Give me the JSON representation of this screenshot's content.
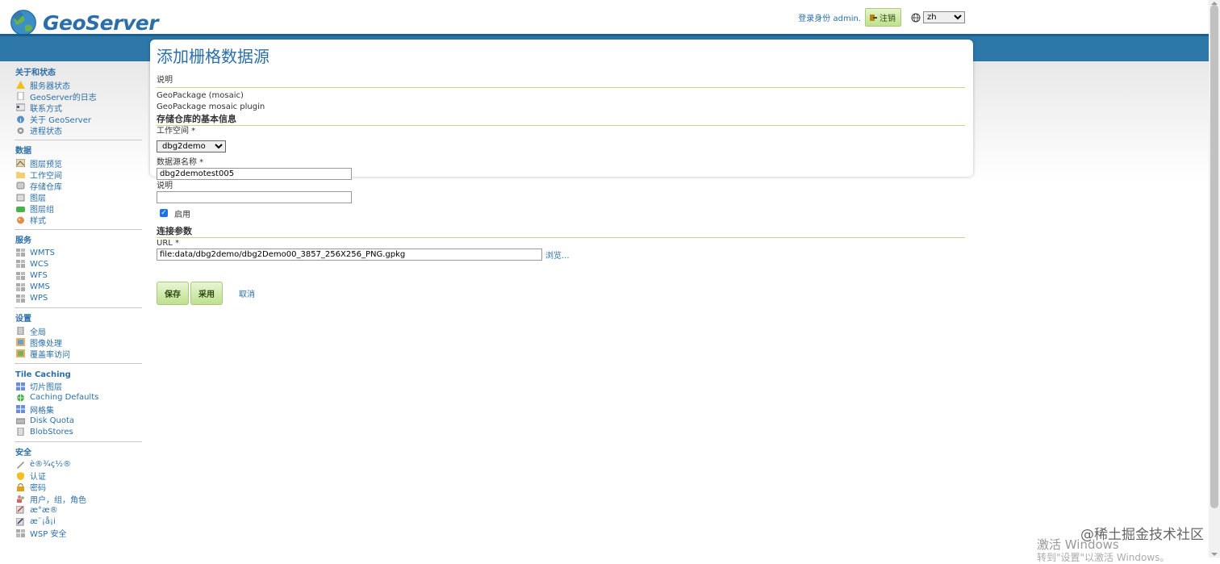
{
  "header": {
    "brand": "GeoServer",
    "user_text": "登录身份 admin.",
    "logout_label": "注销",
    "lang_selected": "zh"
  },
  "sidebar": {
    "sections": [
      {
        "title": "关于和状态",
        "items": [
          "服务器状态",
          "GeoServer的日志",
          "联系方式",
          "关于 GeoServer",
          "进程状态"
        ]
      },
      {
        "title": "数据",
        "items": [
          "图层预览",
          "工作空间",
          "存储仓库",
          "图层",
          "图层组",
          "样式"
        ]
      },
      {
        "title": "服务",
        "items": [
          "WMTS",
          "WCS",
          "WFS",
          "WMS",
          "WPS"
        ]
      },
      {
        "title": "设置",
        "items": [
          "全局",
          "图像处理",
          "覆盖率访问"
        ]
      },
      {
        "title": "Tile Caching",
        "items": [
          "切片图层",
          "Caching Defaults",
          "网格集",
          "Disk Quota",
          "BlobStores"
        ]
      },
      {
        "title": "安全",
        "items": [
          "è®¾ç½®",
          "认证",
          "密码",
          "用户，组，角色",
          "æ°æ®",
          "æ¨¡å¡i",
          "WSP 安全"
        ]
      }
    ]
  },
  "main": {
    "title": "添加栅格数据源",
    "description_label": "说明",
    "source_type": "GeoPackage (mosaic)",
    "source_desc": "GeoPackage mosaic plugin",
    "basic_info_heading": "存储仓库的基本信息",
    "workspace_label": "工作空间 *",
    "workspace_value": "dbg2demo",
    "datasource_name_label": "数据源名称 *",
    "datasource_name_value": "dbg2demotest005",
    "desc_label": "说明",
    "desc_value": "",
    "enabled_label": "启用",
    "connection_heading": "连接参数",
    "url_label": "URL *",
    "url_value": "file:data/dbg2demo/dbg2Demo00_3857_256X256_PNG.gpkg",
    "browse_label": "浏览...",
    "save_label": "保存",
    "apply_label": "采用",
    "cancel_label": "取消"
  },
  "watermark": {
    "juejin": "@稀土掘金技术社区",
    "activate": "激活 Windows",
    "activate_sub": "转到\"设置\"以激活 Windows。"
  },
  "colors": {
    "accent": "#2b6ea7",
    "band": "#2d78a8",
    "button_green": "#bee08f"
  }
}
